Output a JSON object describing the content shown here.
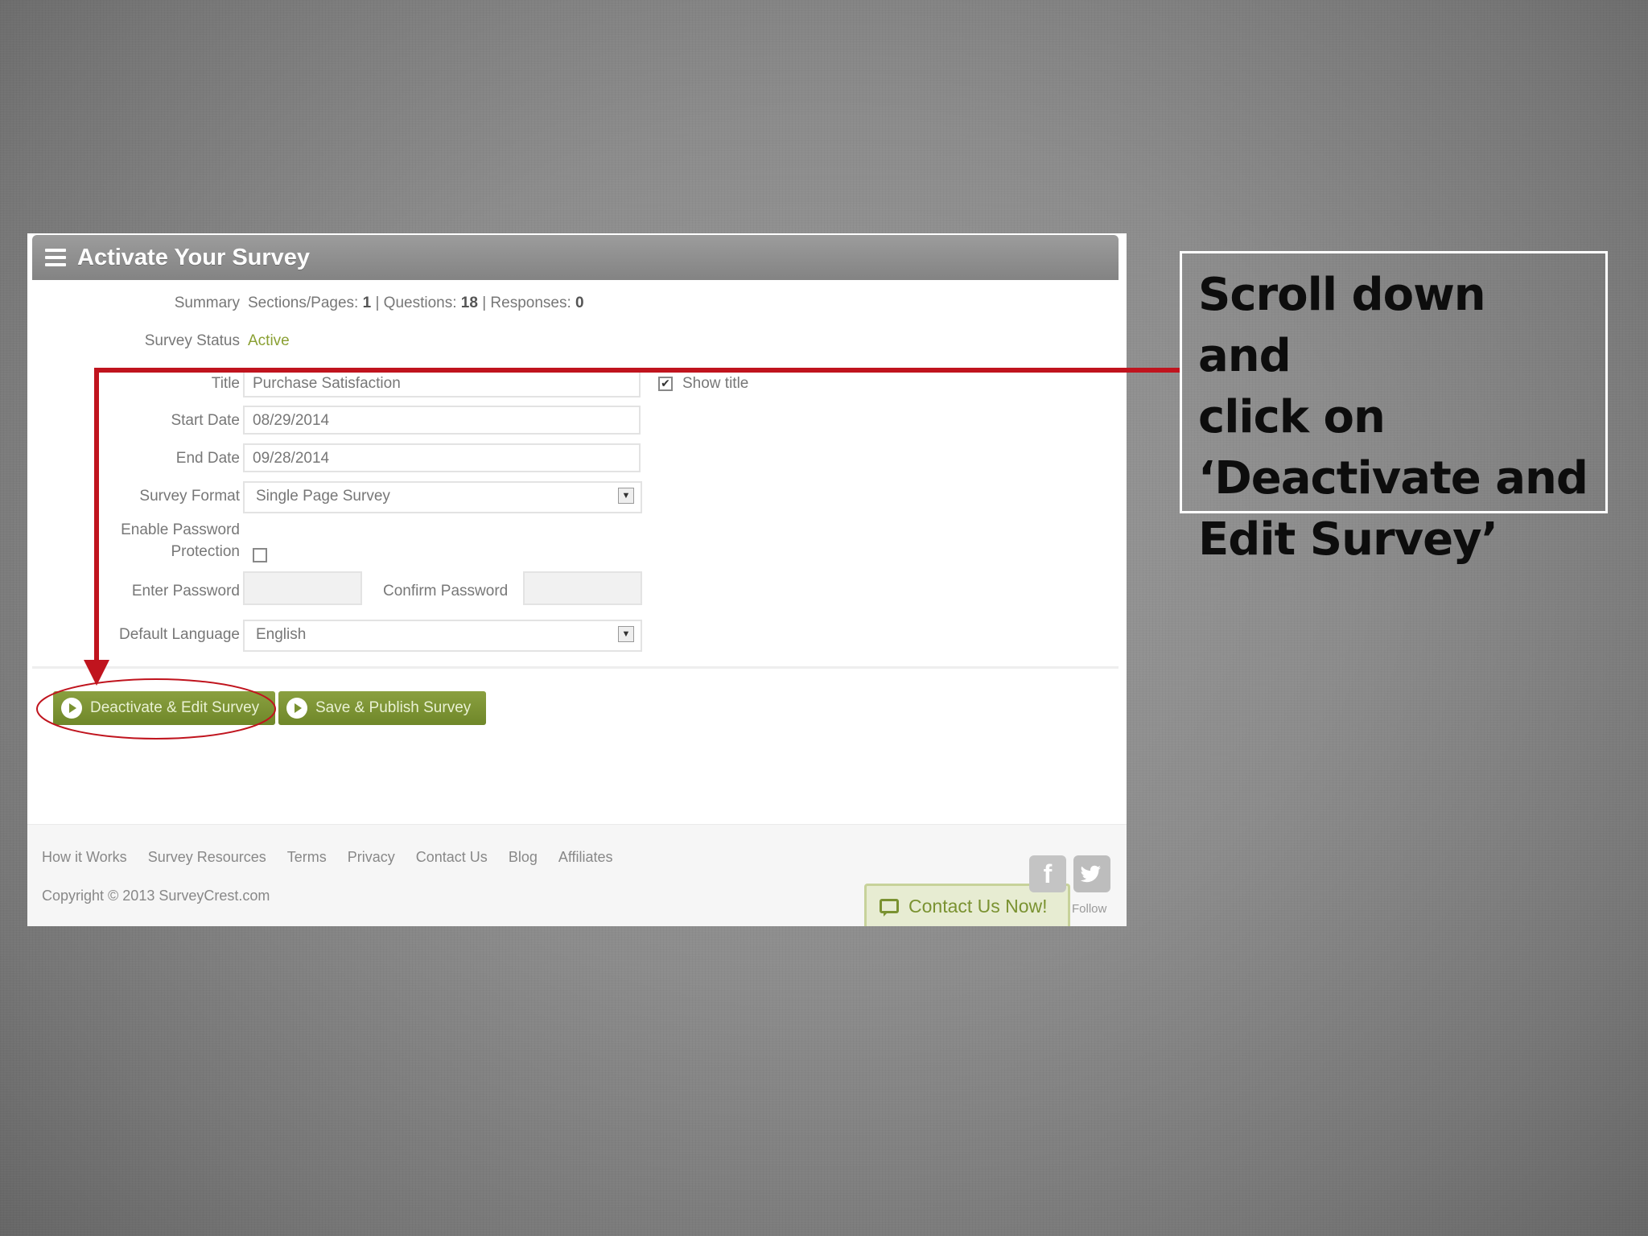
{
  "panel": {
    "title": "Activate Your Survey"
  },
  "summary": {
    "label": "Summary",
    "sections_label": "Sections/Pages:",
    "sections_value": "1",
    "questions_label": "| Questions:",
    "questions_value": "18",
    "responses_label": "| Responses:",
    "responses_value": "0"
  },
  "status": {
    "label": "Survey Status",
    "value": "Active"
  },
  "fields": {
    "title_label": "Title",
    "title_value": "Purchase Satisfaction",
    "show_title_label": "Show title",
    "start_label": "Start Date",
    "start_value": "08/29/2014",
    "end_label": "End Date",
    "end_value": "09/28/2014",
    "format_label": "Survey Format",
    "format_value": "Single Page Survey",
    "password_label_1": "Enable Password",
    "password_label_2": "Protection",
    "enter_password_label": "Enter Password",
    "confirm_password_label": "Confirm Password",
    "language_label": "Default Language",
    "language_value": "English"
  },
  "buttons": {
    "deactivate": "Deactivate & Edit Survey",
    "publish": "Save & Publish Survey"
  },
  "footer": {
    "links": [
      "How it Works",
      "Survey Resources",
      "Terms",
      "Privacy",
      "Contact Us",
      "Blog",
      "Affiliates"
    ],
    "copyright": "Copyright © 2013 SurveyCrest.com",
    "contact": "Contact Us Now!",
    "follow": "Follow",
    "facebook_glyph": "f"
  },
  "callout": {
    "line1": "Scroll down and",
    "line2": "click on",
    "line3": "‘Deactivate and",
    "line4": "Edit Survey’"
  },
  "colors": {
    "annotation": "#c0141e",
    "button": "#7a9231",
    "status": "#8aa033"
  }
}
